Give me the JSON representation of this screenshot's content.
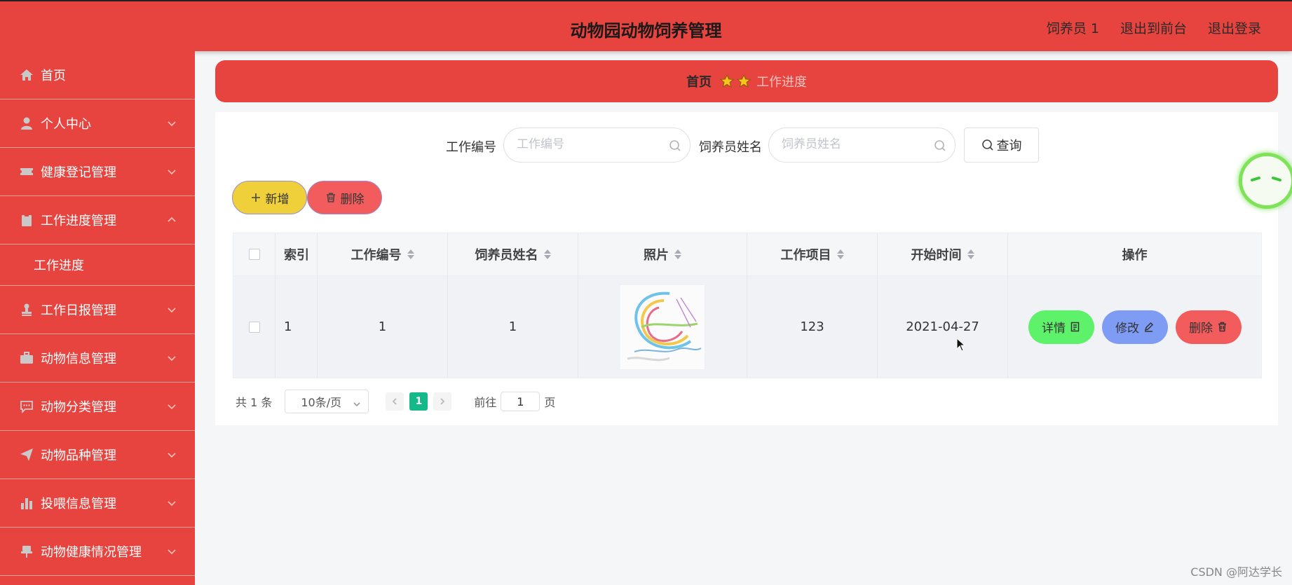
{
  "header": {
    "title": "动物园动物饲养管理",
    "user_label": "饲养员 1",
    "front_label": "退出到前台",
    "logout_label": "退出登录"
  },
  "sidebar": {
    "items": [
      {
        "label": "首页",
        "icon": "home-icon"
      },
      {
        "label": "个人中心",
        "icon": "user-icon"
      },
      {
        "label": "健康登记管理",
        "icon": "ticket-icon"
      },
      {
        "label": "工作进度管理",
        "icon": "clipboard-icon",
        "expanded": true
      },
      {
        "label": "工作日报管理",
        "icon": "stamp-icon"
      },
      {
        "label": "动物信息管理",
        "icon": "briefcase-icon"
      },
      {
        "label": "动物分类管理",
        "icon": "chat-icon"
      },
      {
        "label": "动物品种管理",
        "icon": "paper-plane-icon"
      },
      {
        "label": "投喂信息管理",
        "icon": "bar-chart-icon"
      },
      {
        "label": "动物健康情况管理",
        "icon": "pushpin-icon"
      }
    ],
    "submenu": {
      "label": "工作进度"
    }
  },
  "breadcrumb": {
    "home": "首页",
    "current": "工作进度"
  },
  "search": {
    "field1_label": "工作编号",
    "field1_placeholder": "工作编号",
    "field2_label": "饲养员姓名",
    "field2_placeholder": "饲养员姓名",
    "query_label": "查询"
  },
  "actions": {
    "add_label": "新增",
    "delete_label": "删除"
  },
  "colors": {
    "primary_red": "#e8443f",
    "add_yellow": "#f0d03a",
    "delete_red": "#f25c5c",
    "detail_green": "#5ef26a",
    "edit_blue": "#7f9cf5",
    "page_active": "#14b98a"
  },
  "table": {
    "columns": [
      "索引",
      "工作编号",
      "饲养员姓名",
      "照片",
      "工作项目",
      "开始时间",
      "操作"
    ],
    "rows": [
      {
        "index": "1",
        "work_no": "1",
        "keeper_name": "1",
        "project": "123",
        "start_time": "2021-04-27"
      }
    ],
    "row_buttons": {
      "detail": "详情",
      "edit": "修改",
      "delete": "删除"
    }
  },
  "pagination": {
    "total_text": "共 1 条",
    "page_size": "10条/页",
    "current_page": "1",
    "goto_label": "前往",
    "goto_value": "1",
    "page_suffix": "页"
  },
  "watermark": "CSDN @阿达学长"
}
